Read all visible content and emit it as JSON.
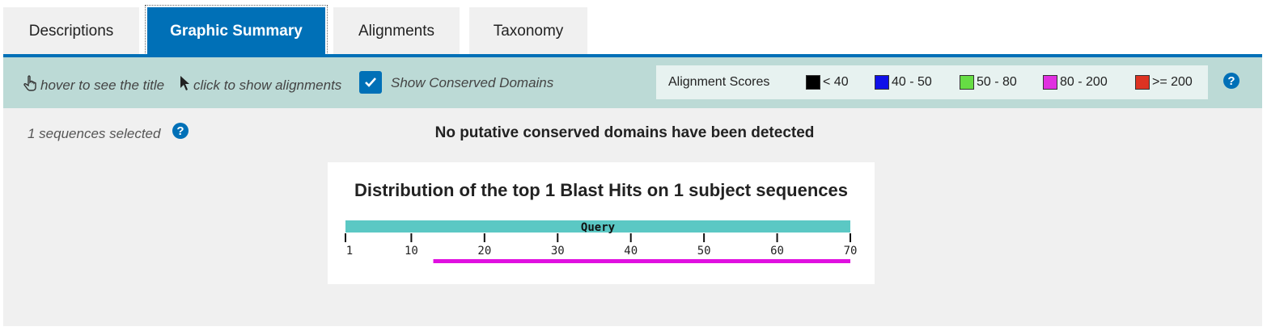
{
  "tabs": [
    {
      "label": "Descriptions",
      "active": false
    },
    {
      "label": "Graphic Summary",
      "active": true
    },
    {
      "label": "Alignments",
      "active": false
    },
    {
      "label": "Taxonomy",
      "active": false
    }
  ],
  "toolbar": {
    "hover_hint": "hover to see the title",
    "click_hint": "click to show alignments",
    "show_conserved_label": "Show Conserved Domains",
    "show_conserved_checked": true,
    "legend_title": "Alignment Scores",
    "legend": [
      {
        "label": "< 40",
        "color": "#000000"
      },
      {
        "label": "40 - 50",
        "color": "#1010e8"
      },
      {
        "label": "50 - 80",
        "color": "#66dd44"
      },
      {
        "label": "80 - 200",
        "color": "#e030e0"
      },
      {
        "label": ">= 200",
        "color": "#dd3322"
      }
    ],
    "help_icon": "?"
  },
  "main": {
    "selected_text": "1 sequences selected",
    "help_icon": "?",
    "no_domains_text": "No putative conserved domains have been detected",
    "graphic_title": "Distribution of the top 1 Blast Hits on 1 subject sequences"
  },
  "chart_data": {
    "type": "bar",
    "query_label": "Query",
    "query_color": "#5bc8c4",
    "x_range": [
      1,
      70
    ],
    "ticks": [
      1,
      10,
      20,
      30,
      40,
      50,
      60,
      70
    ],
    "hits": [
      {
        "start": 13,
        "end": 70,
        "color": "#e010e0"
      }
    ]
  }
}
